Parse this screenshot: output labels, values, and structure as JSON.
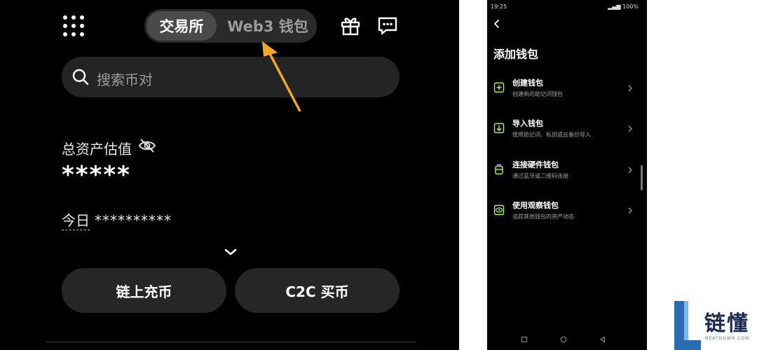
{
  "left_app": {
    "tabs": {
      "active": "交易所",
      "inactive": "Web3 钱包"
    },
    "search": {
      "placeholder": "搜索币对"
    },
    "assets": {
      "label": "总资产估值",
      "value": "*****"
    },
    "today": {
      "label": "今日",
      "value": "**********"
    },
    "buttons": {
      "deposit": "链上充币",
      "buy": "C2C 买币"
    },
    "arrow_color": "#F5A623",
    "icons": [
      "grid-menu-icon",
      "gift-icon",
      "message-icon",
      "search-icon",
      "eye-off-icon",
      "chevron-down-icon"
    ]
  },
  "right_app": {
    "status": {
      "time": "19:25",
      "battery": "100%"
    },
    "title": "添加钱包",
    "accent": "#B8F26B",
    "items": [
      {
        "title": "创建钱包",
        "subtitle": "创建新的助记词钱包",
        "icon": "create-wallet-icon"
      },
      {
        "title": "导入钱包",
        "subtitle": "使用助记词、私钥或云备份导入",
        "icon": "import-wallet-icon"
      },
      {
        "title": "连接硬件钱包",
        "subtitle": "通过蓝牙或二维码连接",
        "icon": "hardware-wallet-icon"
      },
      {
        "title": "使用观察钱包",
        "subtitle": "追踪其他钱包的资产动态",
        "icon": "watch-wallet-icon"
      }
    ]
  },
  "watermark": {
    "text": "链懂",
    "sub": "NEATDOWN.COM"
  }
}
